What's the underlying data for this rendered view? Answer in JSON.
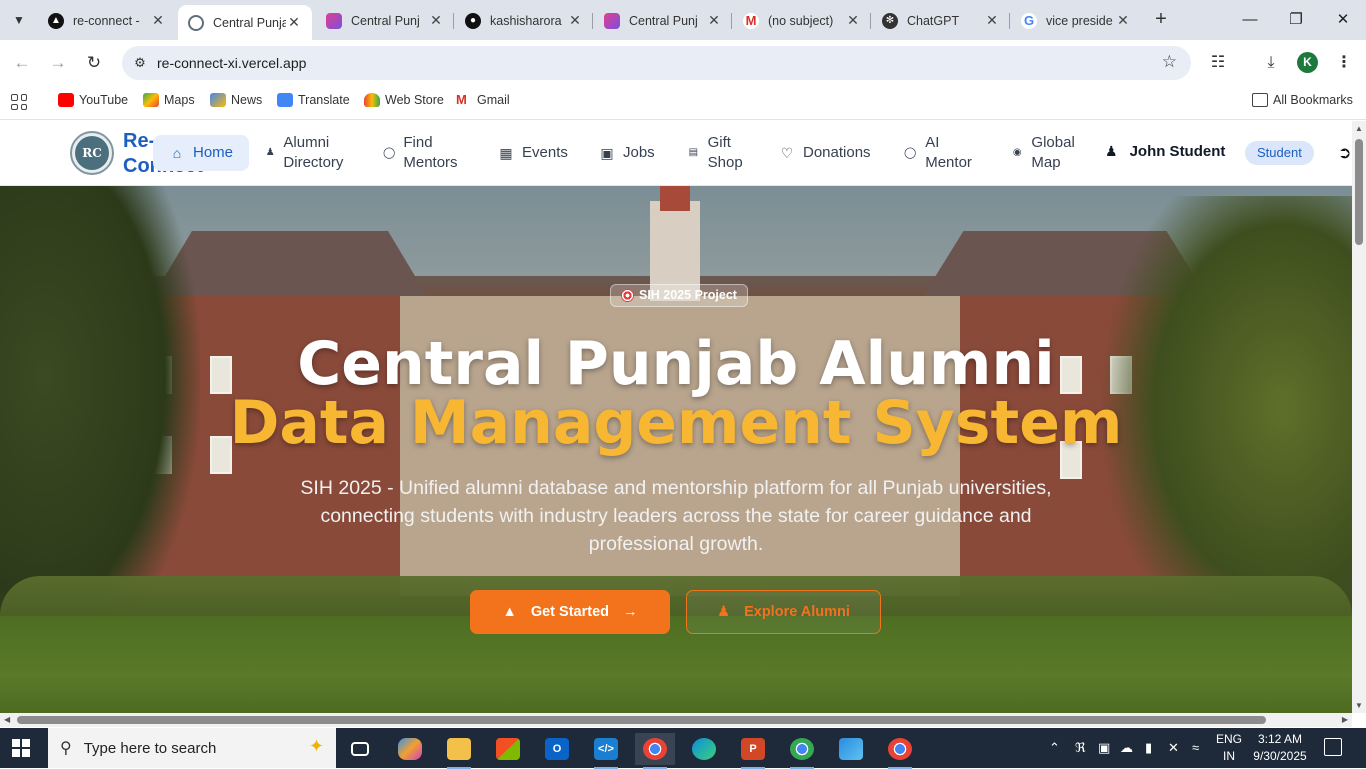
{
  "browser": {
    "tabs": [
      {
        "title": "re-connect -",
        "active": false
      },
      {
        "title": "Central Punja",
        "active": true
      },
      {
        "title": "Central Punj",
        "active": false
      },
      {
        "title": "kashisharora",
        "active": false
      },
      {
        "title": "Central Punj",
        "active": false
      },
      {
        "title": "(no subject)",
        "active": false
      },
      {
        "title": "ChatGPT",
        "active": false
      },
      {
        "title": "vice preside",
        "active": false
      }
    ],
    "url": "re-connect-xi.vercel.app",
    "profile_initial": "K",
    "bookmarks": [
      "YouTube",
      "Maps",
      "News",
      "Translate",
      "Web Store",
      "Gmail"
    ],
    "all_bookmarks": "All Bookmarks"
  },
  "site": {
    "brand": "Re-Connect",
    "logo_text": "RC",
    "nav": [
      {
        "label": "Home"
      },
      {
        "label": "Alumni Directory"
      },
      {
        "label": "Find Mentors"
      },
      {
        "label": "Events"
      },
      {
        "label": "Jobs"
      },
      {
        "label": "Gift Shop"
      },
      {
        "label": "Donations"
      },
      {
        "label": "AI Mentor"
      },
      {
        "label": "Global Map"
      }
    ],
    "user_name": "John Student",
    "role": "Student"
  },
  "hero": {
    "badge": "SIH 2025 Project",
    "title_line1": "Central Punjab Alumni",
    "title_line2": "Data Management System",
    "subtitle": "SIH 2025 - Unified alumni database and mentorship platform for all Punjab universities, connecting students with industry leaders across the state for career guidance and professional growth.",
    "cta_primary": "Get Started",
    "cta_secondary": "Explore Alumni"
  },
  "taskbar": {
    "search_placeholder": "Type here to search",
    "lang_line1": "ENG",
    "lang_line2": "IN",
    "time": "3:12 AM",
    "date": "9/30/2025"
  },
  "colors": {
    "accent_orange": "#f2731c",
    "title_gold": "#f7b733",
    "brand_blue": "#1d5fbf"
  }
}
